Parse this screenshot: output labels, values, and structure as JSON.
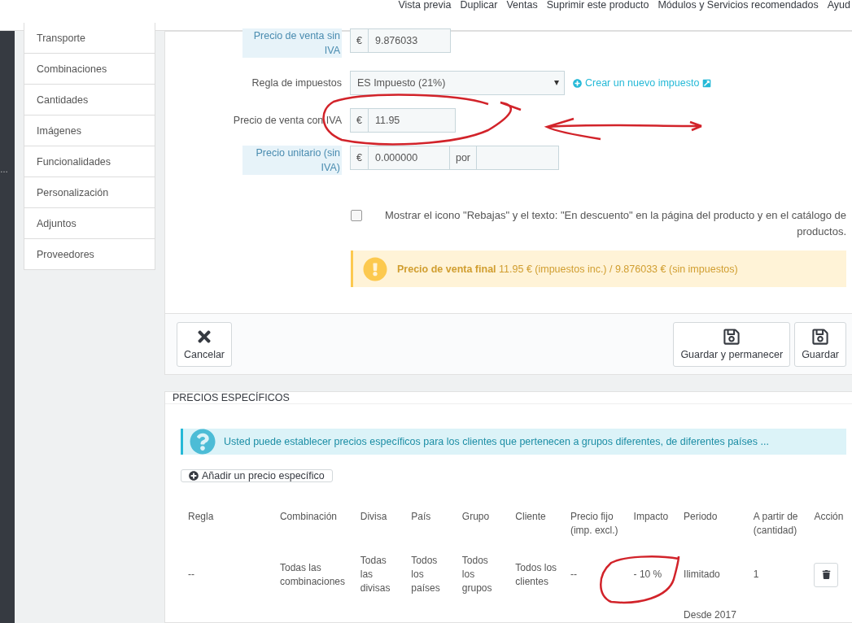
{
  "top_nav": [
    "Vista previa",
    "Duplicar",
    "Ventas",
    "Suprimir este producto",
    "Módulos y Servicios recomendados",
    "Ayud"
  ],
  "sidebar_strip": {
    "text": "…"
  },
  "side_tabs": [
    "Transporte",
    "Combinaciones",
    "Cantidades",
    "Imágenes",
    "Funcionalidades",
    "Personalización",
    "Adjuntos",
    "Proveedores"
  ],
  "form": {
    "rows": [
      {
        "kind": "input",
        "label": "Precio de venta sin IVA",
        "hint_label": true,
        "prefix": "€",
        "value": "9.876033"
      },
      {
        "kind": "select",
        "label": "Regla de impuestos",
        "hint_label": false,
        "value": "ES Impuesto (21%)",
        "link": "Crear un nuevo impuesto"
      },
      {
        "kind": "input",
        "label": "Precio de venta con IVA",
        "hint_label": false,
        "prefix": "€",
        "value": "11.95"
      },
      {
        "kind": "unit",
        "label": "Precio unitario (sin IVA)",
        "hint_label": true,
        "prefix": "€",
        "value": "0.000000",
        "unit_label": "por"
      }
    ]
  },
  "on_sale": {
    "checked": false,
    "text": "Mostrar el icono \"Rebajas\" y el texto: \"En descuento\" en la página del producto y en el catálogo de productos."
  },
  "final_price": {
    "text": "**Precio de venta final** 11.95 € (impuestos inc.) / 9.876033 € (sin impuestos)"
  },
  "footer_buttons": [
    {
      "kind": "cancel",
      "label": "Cancelar"
    },
    {
      "kind": "save",
      "label": "Guardar y permanecer"
    },
    {
      "kind": "save",
      "label": "Guardar"
    }
  ],
  "specific_prices": {
    "title": "PRECIOS ESPECÍFICOS",
    "info": "Usted puede establecer precios específicos para los clientes que pertenecen a grupos diferentes, de diferentes países ...",
    "add_button": "Añadir un precio específico",
    "table": {
      "columns": [
        "Regla",
        "Combinación",
        "Divisa",
        "País",
        "Grupo",
        "Cliente",
        "Precio fijo (imp. excl.)",
        "Impacto",
        "Periodo",
        "A partir de (cantidad)",
        "Acción"
      ],
      "rows": [
        {
          "cells": [
            "--",
            "Todas las combinaciones",
            "Todas las divisas",
            "Todos los países",
            "Todos los grupos",
            "Todos los clientes",
            "--",
            "- 10 %",
            "Ilimitado",
            "1",
            null
          ],
          "deletable": true
        },
        {
          "cells": [
            null,
            null,
            null,
            null,
            null,
            null,
            null,
            null,
            "Desde 2017",
            null,
            null
          ]
        }
      ]
    }
  }
}
